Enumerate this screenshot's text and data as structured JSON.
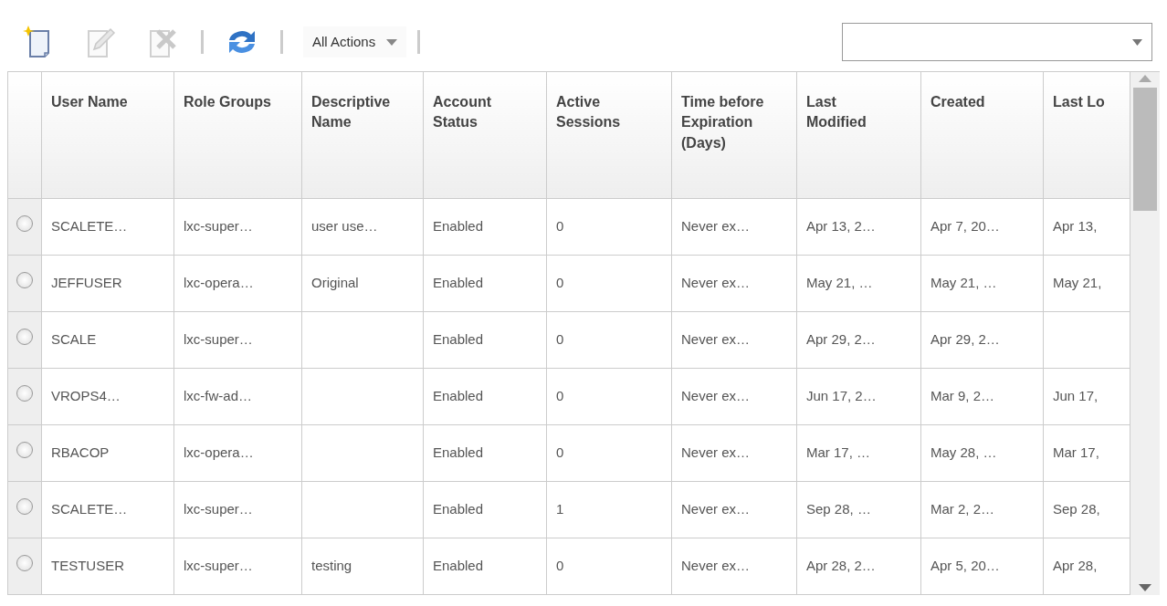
{
  "toolbar": {
    "buttons": [
      {
        "kind": "new",
        "disabled": false
      },
      {
        "kind": "edit",
        "disabled": true
      },
      {
        "kind": "delete",
        "disabled": true
      },
      {
        "kind": "refresh",
        "disabled": false
      }
    ],
    "actions_menu": {
      "label": "All Actions"
    }
  },
  "table": {
    "columns": [
      "User Name",
      "Role Groups",
      "Descriptive Name",
      "Account Status",
      "Active Sessions",
      "Time before Expiration (Days)",
      "Last Modified",
      "Created",
      "Last Lo"
    ],
    "rows": [
      {
        "selected": false,
        "cells": [
          "SCALETE…",
          "lxc-super…",
          "user use…",
          "Enabled",
          "0",
          "Never ex…",
          "Apr 13, 2…",
          "Apr 7, 20…",
          "Apr 13,"
        ]
      },
      {
        "selected": false,
        "cells": [
          "JEFFUSER",
          "lxc-opera…",
          "Original",
          "Enabled",
          "0",
          "Never ex…",
          "May 21, …",
          "May 21, …",
          "May 21,"
        ]
      },
      {
        "selected": false,
        "cells": [
          "SCALE",
          "lxc-super…",
          "",
          "Enabled",
          "0",
          "Never ex…",
          "Apr 29, 2…",
          "Apr 29, 2…",
          ""
        ]
      },
      {
        "selected": false,
        "cells": [
          "VROPS4…",
          "lxc-fw-ad…",
          "",
          "Enabled",
          "0",
          "Never ex…",
          "Jun 17, 2…",
          "Mar 9, 2…",
          "Jun 17,"
        ]
      },
      {
        "selected": false,
        "cells": [
          "RBACOP",
          "lxc-opera…",
          "",
          "Enabled",
          "0",
          "Never ex…",
          "Mar 17, …",
          "May 28, …",
          "Mar 17,"
        ]
      },
      {
        "selected": false,
        "cells": [
          "SCALETE…",
          "lxc-super…",
          "",
          "Enabled",
          "1",
          "Never ex…",
          "Sep 28, …",
          "Mar 2, 2…",
          "Sep 28,"
        ]
      },
      {
        "selected": false,
        "cells": [
          "TESTUSER",
          "lxc-super…",
          "testing",
          "Enabled",
          "0",
          "Never ex…",
          "Apr 28, 2…",
          "Apr 5, 20…",
          "Apr 28,"
        ]
      }
    ]
  }
}
